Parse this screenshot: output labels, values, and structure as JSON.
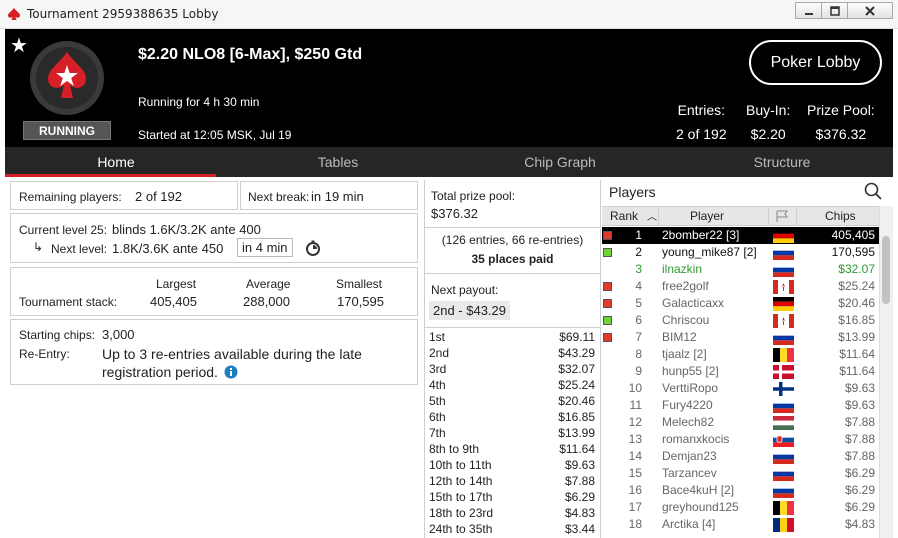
{
  "window": {
    "title": "Tournament 2959388635 Lobby",
    "controls": [
      "minimize",
      "maximize",
      "close"
    ]
  },
  "header": {
    "tournament_name": "$2.20 NLO8 [6-Max], $250 Gtd",
    "status_badge": "RUNNING",
    "running_for": "Running for 4 h 30 min",
    "started_at": "Started at 12:05 MSK, Jul 19",
    "lobby_button": "Poker Lobby",
    "entries_label": "Entries:",
    "entries_value": "2 of 192",
    "buyin_label": "Buy-In:",
    "buyin_value": "$2.20",
    "prize_label": "Prize Pool:",
    "prize_value": "$376.32"
  },
  "tabs": [
    {
      "label": "Home",
      "active": true
    },
    {
      "label": "Tables",
      "active": false
    },
    {
      "label": "Chip Graph",
      "active": false
    },
    {
      "label": "Structure",
      "active": false
    }
  ],
  "home": {
    "remaining_label": "Remaining players:",
    "remaining_value": "2 of 192",
    "next_break_label": "Next break:",
    "next_break_value": "in 19 min",
    "current_level_label": "Current level 25:",
    "current_level_value": "blinds 1.6K/3.2K ante 400",
    "next_level_label": "Next level:",
    "next_level_value": "1.8K/3.6K ante 450",
    "next_level_time": "in 4 min",
    "stack_label": "Tournament stack:",
    "largest_label": "Largest",
    "largest_value": "405,405",
    "average_label": "Average",
    "average_value": "288,000",
    "smallest_label": "Smallest",
    "smallest_value": "170,595",
    "starting_chips_label": "Starting chips:",
    "starting_chips_value": "3,000",
    "reentry_label": "Re-Entry:",
    "reentry_line1": "Up to 3 re-entries available during the late",
    "reentry_line2": "registration period."
  },
  "prize": {
    "total_label": "Total prize pool:",
    "total_value": "$376.32",
    "entries_note": "(126 entries, 66 re-entries)",
    "places_paid": "35 places paid",
    "next_payout_label": "Next payout:",
    "next_payout_value": "2nd - $43.29",
    "payouts": [
      {
        "place": "1st",
        "amount": "$69.11"
      },
      {
        "place": "2nd",
        "amount": "$43.29"
      },
      {
        "place": "3rd",
        "amount": "$32.07"
      },
      {
        "place": "4th",
        "amount": "$25.24"
      },
      {
        "place": "5th",
        "amount": "$20.46"
      },
      {
        "place": "6th",
        "amount": "$16.85"
      },
      {
        "place": "7th",
        "amount": "$13.99"
      },
      {
        "place": "8th to 9th",
        "amount": "$11.64"
      },
      {
        "place": "10th to 11th",
        "amount": "$9.63"
      },
      {
        "place": "12th to 14th",
        "amount": "$7.88"
      },
      {
        "place": "15th to 17th",
        "amount": "$6.29"
      },
      {
        "place": "18th to 23rd",
        "amount": "$4.83"
      },
      {
        "place": "24th to 35th",
        "amount": "$3.44"
      }
    ]
  },
  "players": {
    "title": "Players",
    "col_rank": "Rank",
    "col_player": "Player",
    "col_chips": "Chips",
    "rows": [
      {
        "rank": "1",
        "name": "2bomber22 [3]",
        "chips": "405,405",
        "style": "me",
        "indicator": "red",
        "flag": "de"
      },
      {
        "rank": "2",
        "name": "young_mike87 [2]",
        "chips": "170,595",
        "style": "playing",
        "indicator": "green",
        "flag": "ru"
      },
      {
        "rank": "3",
        "name": "ilnazkin",
        "chips": "$32.07",
        "style": "ready",
        "indicator": "none",
        "flag": "ru"
      },
      {
        "rank": "4",
        "name": "free2golf",
        "chips": "$25.24",
        "style": "out",
        "indicator": "red",
        "flag": "ca"
      },
      {
        "rank": "5",
        "name": "Galacticaxx",
        "chips": "$20.46",
        "style": "out",
        "indicator": "red",
        "flag": "de"
      },
      {
        "rank": "6",
        "name": "Chriscou",
        "chips": "$16.85",
        "style": "out",
        "indicator": "green",
        "flag": "ca"
      },
      {
        "rank": "7",
        "name": "BIM12",
        "chips": "$13.99",
        "style": "out",
        "indicator": "red",
        "flag": "ru"
      },
      {
        "rank": "8",
        "name": "tjaalz [2]",
        "chips": "$11.64",
        "style": "out",
        "indicator": "none",
        "flag": "be"
      },
      {
        "rank": "9",
        "name": "hunp55 [2]",
        "chips": "$11.64",
        "style": "out",
        "indicator": "none",
        "flag": "dk"
      },
      {
        "rank": "10",
        "name": "VerttiRopo",
        "chips": "$9.63",
        "style": "out",
        "indicator": "none",
        "flag": "fi"
      },
      {
        "rank": "11",
        "name": "Fury4220",
        "chips": "$9.63",
        "style": "out",
        "indicator": "none",
        "flag": "ru"
      },
      {
        "rank": "12",
        "name": "Melech82",
        "chips": "$7.88",
        "style": "out",
        "indicator": "none",
        "flag": "hu"
      },
      {
        "rank": "13",
        "name": "romanxkocis",
        "chips": "$7.88",
        "style": "out",
        "indicator": "none",
        "flag": "sk"
      },
      {
        "rank": "14",
        "name": "Demjan23",
        "chips": "$7.88",
        "style": "out",
        "indicator": "none",
        "flag": "ru"
      },
      {
        "rank": "15",
        "name": "Tarzancev",
        "chips": "$6.29",
        "style": "out",
        "indicator": "none",
        "flag": "ru"
      },
      {
        "rank": "16",
        "name": "Bace4kuH [2]",
        "chips": "$6.29",
        "style": "out",
        "indicator": "none",
        "flag": "ru"
      },
      {
        "rank": "17",
        "name": "greyhound125",
        "chips": "$6.29",
        "style": "out",
        "indicator": "none",
        "flag": "be"
      },
      {
        "rank": "18",
        "name": "Arctika [4]",
        "chips": "$4.83",
        "style": "out",
        "indicator": "none",
        "flag": "ro"
      }
    ]
  },
  "colors": {
    "accent_red": "#d61f26",
    "header_bg": "#000000",
    "tab_bg": "#262626",
    "ready_green": "#2f9a2f",
    "indicator_red": "#e03a2c",
    "indicator_green": "#6fd23a"
  }
}
